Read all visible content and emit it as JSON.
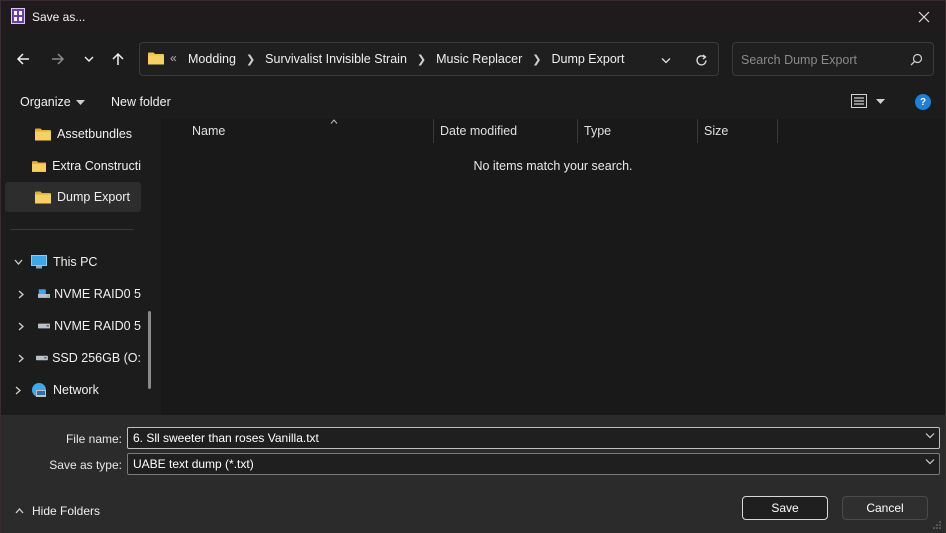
{
  "window": {
    "title": "Save as..."
  },
  "address": {
    "overflow": "«",
    "crumbs": [
      "Modding",
      "Survivalist Invisible Strain",
      "Music Replacer",
      "Dump Export"
    ]
  },
  "search": {
    "placeholder": "Search Dump Export"
  },
  "toolbar": {
    "organize_label": "Organize",
    "new_folder_label": "New folder",
    "help_label": "?"
  },
  "navpane": {
    "items": [
      {
        "label": "Assetbundles",
        "icon": "folder-icon"
      },
      {
        "label": "Extra Constructi",
        "icon": "folder-icon"
      },
      {
        "label": "Dump Export",
        "icon": "folder-icon",
        "selected": true
      },
      {
        "label": "This PC",
        "icon": "pc-icon",
        "expanded": true
      },
      {
        "label": "NVME RAID0 5",
        "icon": "network-drive-icon"
      },
      {
        "label": "NVME RAID0 5",
        "icon": "drive-icon"
      },
      {
        "label": "SSD 256GB (O:",
        "icon": "drive-icon"
      },
      {
        "label": "Network",
        "icon": "network-icon"
      }
    ]
  },
  "content": {
    "columns": [
      "Name",
      "Date modified",
      "Type",
      "Size"
    ],
    "empty_message": "No items match your search."
  },
  "form": {
    "file_name_label": "File name:",
    "file_name_value": "6. Sll sweeter than roses Vanilla.txt",
    "save_type_label": "Save as type:",
    "save_type_value": "UABE text dump (*.txt)"
  },
  "footer": {
    "hide_folders_label": "Hide Folders",
    "save_label": "Save",
    "cancel_label": "Cancel"
  },
  "colors": {
    "accent": "#1e7fd8",
    "folder": "#f2c14e",
    "background": "#191919"
  }
}
